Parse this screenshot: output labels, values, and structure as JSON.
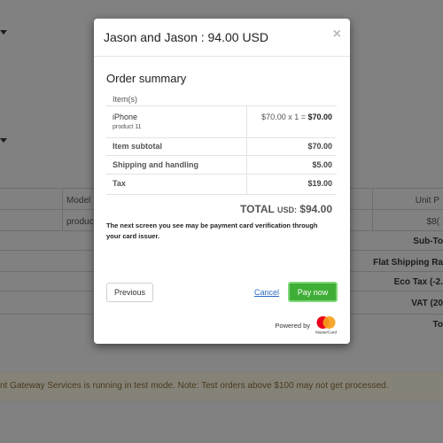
{
  "modal": {
    "title": "Jason and Jason : 94.00 USD",
    "close_glyph": "×",
    "summary_title": "Order summary",
    "items_header": "Item(s)",
    "item": {
      "name": "iPhone",
      "sub": "product 11",
      "unit_price": "$70.00",
      "qty_expr": " x 1 = ",
      "line_total": "$70.00"
    },
    "rows": [
      {
        "label": "Item subtotal",
        "value": "$70.00"
      },
      {
        "label": "Shipping and handling",
        "value": "$5.00"
      },
      {
        "label": "Tax",
        "value": "$19.00"
      }
    ],
    "total_label": "TOTAL ",
    "total_currency": "USD:",
    "total_value": " $94.00",
    "note": "The next screen you see may be payment card verification through your card issuer.",
    "previous_label": "Previous",
    "cancel_label": "Cancel",
    "pay_label": "Pay now",
    "powered_by": "Powered by",
    "brand_text": "MasterCard",
    "colors": {
      "pay": "#3fae36",
      "cancel_link": "#2a6cc0",
      "mc_red": "#eb001b",
      "mc_orange": "#f79e1b"
    }
  },
  "background": {
    "table_headers": {
      "model": "Model",
      "unit_price": "Unit P"
    },
    "row_model": "product",
    "row_price": "$8(",
    "totals": [
      "Sub-To",
      "Flat Shipping Ra",
      "Eco Tax (-2.",
      "VAT (20",
      "To"
    ],
    "alert": "nt Gateway Services is running in test mode. Note: Test orders above $100 may not get processed."
  }
}
